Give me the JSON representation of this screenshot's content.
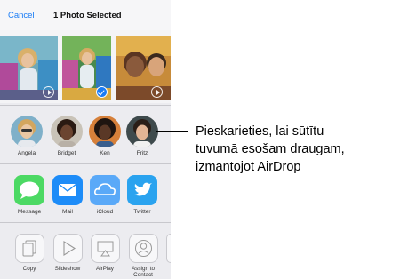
{
  "header": {
    "cancel_label": "Cancel",
    "title": "1 Photo Selected"
  },
  "contacts": [
    {
      "name": "Angela"
    },
    {
      "name": "Bridget"
    },
    {
      "name": "Ken"
    },
    {
      "name": "Fritz"
    }
  ],
  "apps": [
    {
      "label": "Message",
      "icon": "message-icon",
      "color": "#4cd964"
    },
    {
      "label": "Mail",
      "icon": "mail-icon",
      "color": "#1d8cf8"
    },
    {
      "label": "iCloud",
      "icon": "icloud-icon",
      "color": "#5aa9f8"
    },
    {
      "label": "Twitter",
      "icon": "twitter-icon",
      "color": "#2aa3ef"
    }
  ],
  "actions": [
    {
      "label": "Copy",
      "icon": "copy-icon"
    },
    {
      "label": "Slideshow",
      "icon": "slideshow-icon"
    },
    {
      "label": "AirPlay",
      "icon": "airplay-icon"
    },
    {
      "label": "Assign to Contact",
      "icon": "assign-contact-icon"
    }
  ],
  "callout": {
    "line1": "Pieskarieties, lai sūtītu",
    "line2": "tuvumā esošam draugam,",
    "line3": "izmantojot AirDrop"
  },
  "colors": {
    "accent": "#1a7cf5",
    "sheet_bg": "#ececf0"
  }
}
